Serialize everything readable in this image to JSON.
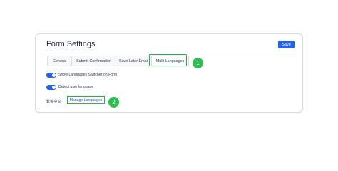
{
  "form": {
    "title": "Form Settings",
    "save_label": "Save",
    "tabs": [
      {
        "label": "General"
      },
      {
        "label": "Submit Confirmation"
      },
      {
        "label": "Save Later Email"
      },
      {
        "label": "Multi Languages"
      }
    ],
    "toggles": [
      {
        "label": "Show Languages Switcher on Form",
        "enabled": true
      },
      {
        "label": "Detect user language",
        "enabled": true
      }
    ],
    "language": {
      "current": "繁體中文",
      "manage_label": "Manage Languages"
    }
  },
  "annotations": {
    "step1": "1",
    "step2": "2"
  },
  "colors": {
    "accent": "#2563eb",
    "highlight": "#22b04b",
    "badge": "#2dbe52"
  }
}
